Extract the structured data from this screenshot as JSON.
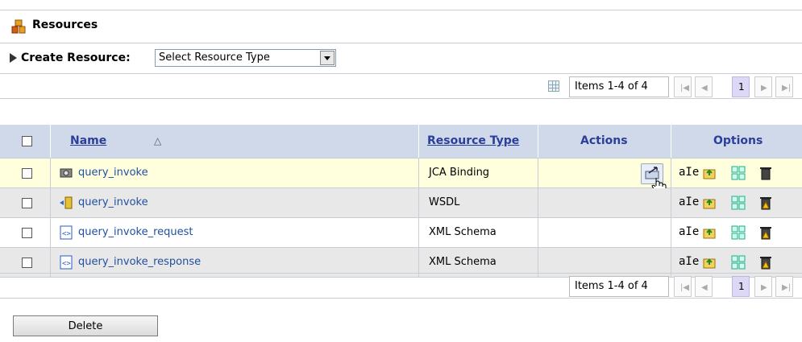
{
  "panel": {
    "title": "Resources",
    "icon": "resources-icon"
  },
  "create": {
    "label": "Create Resource:",
    "select_value": "Select Resource Type"
  },
  "pager": {
    "items": "Items 1-4 of 4",
    "page": "1"
  },
  "table": {
    "headers": {
      "name": "Name",
      "type": "Resource Type",
      "actions": "Actions",
      "options": "Options"
    },
    "rows": [
      {
        "name": "query_invoke",
        "type": "JCA Binding",
        "icon": "jca-binding-icon",
        "highlight": true
      },
      {
        "name": "query_invoke",
        "type": "WSDL",
        "icon": "wsdl-icon",
        "highlight": false
      },
      {
        "name": "query_invoke_request",
        "type": "XML Schema",
        "icon": "xml-schema-icon",
        "highlight": false
      },
      {
        "name": "query_invoke_response",
        "type": "XML Schema",
        "icon": "xml-schema-icon",
        "highlight": false
      }
    ],
    "option_label": "aIe"
  },
  "delete_label": "Delete",
  "colors": {
    "header_bg": "#cfd9ea",
    "highlight_row": "#ffffdd",
    "alt_row": "#e8e8e8",
    "link": "#2050a0"
  }
}
